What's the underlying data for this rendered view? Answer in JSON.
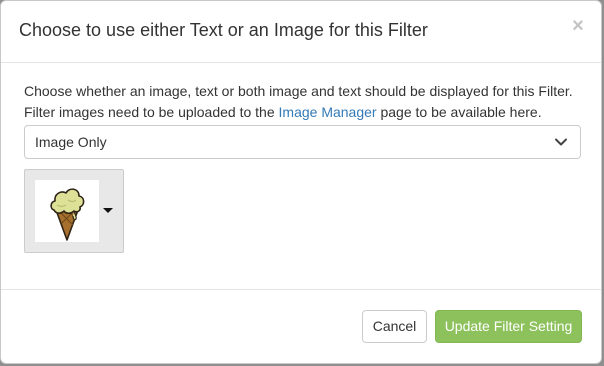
{
  "modal": {
    "title": "Choose to use either Text or an Image for this Filter",
    "close_label": "×"
  },
  "body": {
    "description_before_link": "Choose whether an image, text or both image and text should be displayed for this Filter. Filter images need to be uploaded to the ",
    "description_link": "Image Manager",
    "description_after_link": " page to be available here.",
    "display_select": {
      "selected": "Image Only"
    },
    "image_picker": {
      "image_icon": "ice-cream-cone-icon",
      "caret_icon": "caret-down-icon"
    }
  },
  "footer": {
    "cancel_label": "Cancel",
    "submit_label": "Update Filter Setting"
  },
  "colors": {
    "primary_button": "#8cc15c",
    "link": "#337ab7"
  }
}
